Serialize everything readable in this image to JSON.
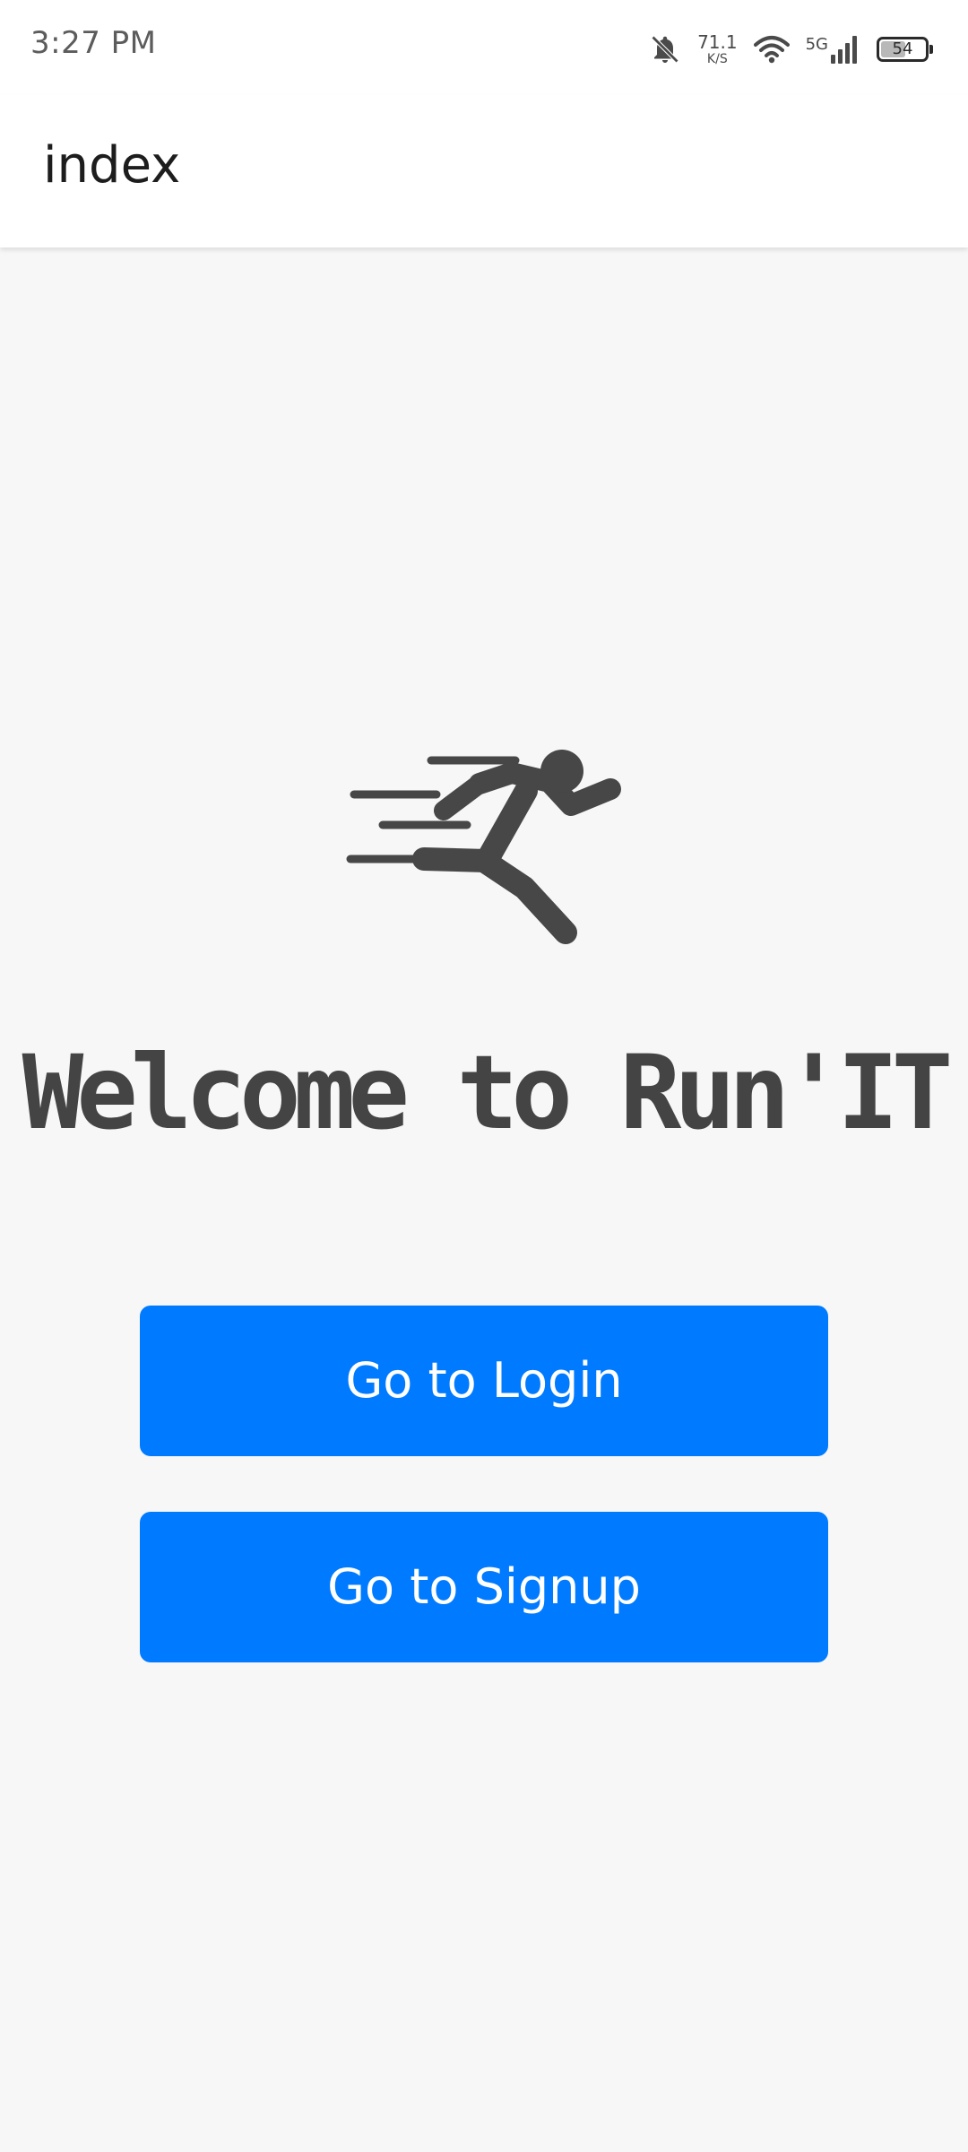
{
  "status_bar": {
    "time": "3:27 PM",
    "net_speed_value": "71.1",
    "net_speed_unit": "K/S",
    "network_type": "5G",
    "battery_level": "54"
  },
  "app_bar": {
    "title": "index"
  },
  "main": {
    "welcome_text": "Welcome to Run'IT",
    "login_label": "Go to Login",
    "signup_label": "Go to Signup"
  },
  "icons": {
    "hero": "running-person-icon",
    "notifications": "bell-off-icon",
    "wifi": "wifi-icon",
    "signal": "signal-bars-icon",
    "battery": "battery-icon"
  },
  "colors": {
    "primary_button": "#007bff",
    "background": "#f7f7f7",
    "app_bar": "#ffffff",
    "heading_text": "#444444"
  }
}
